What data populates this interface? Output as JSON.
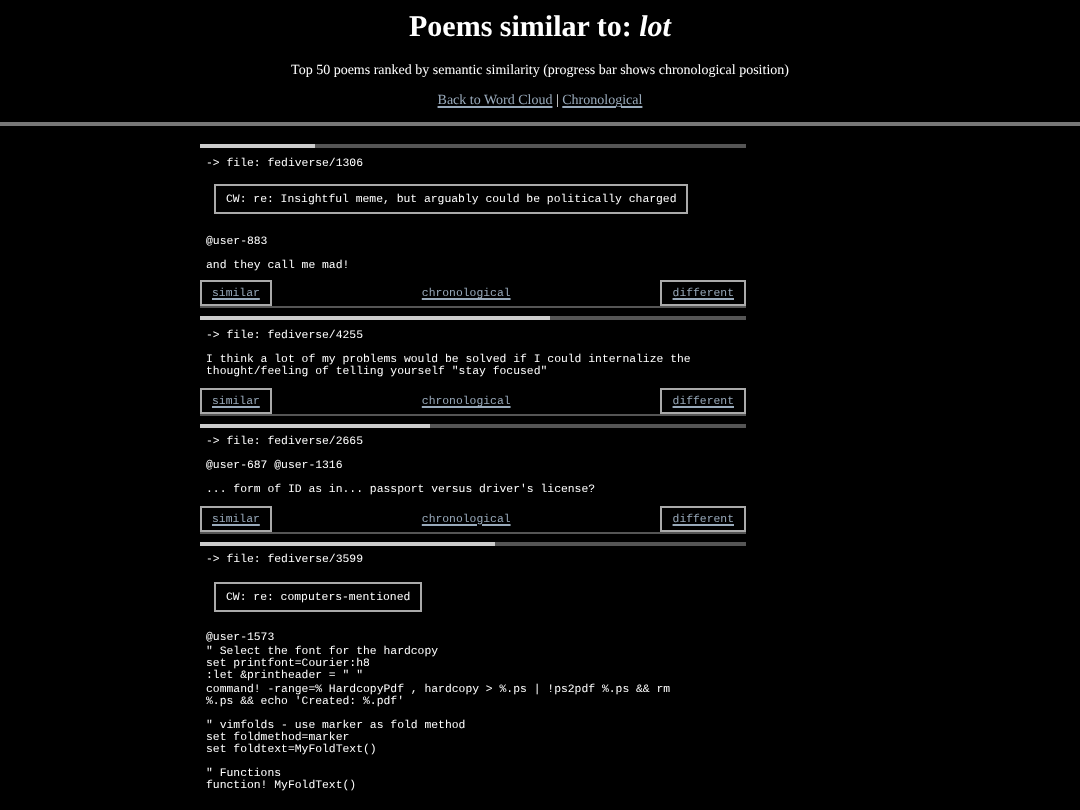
{
  "header": {
    "title": "Poems similar to:",
    "query": "lot",
    "subtitle": "Top 50 poems ranked by semantic similarity (progress bar shows chronological position)",
    "links": [
      "Back to Word Cloud",
      "Chronological"
    ],
    "separator": "|"
  },
  "poems": [
    {
      "level": 0.21,
      "file": "-> file: fediverse/1306",
      "cw": "CW: re: Insightful meme, but arguably could be politically charged",
      "paragraphs": [
        "@user-883",
        "and they call me mad!"
      ],
      "buttons": {
        "similar": "similar",
        "chronological": "chronological",
        "different": "different"
      }
    },
    {
      "level": 0.64,
      "file": "-> file: fediverse/4255",
      "paragraphs": [
        "I think a lot of my problems would be solved if I could internalize the\nthought/feeling of telling yourself \"stay focused\""
      ],
      "buttons": {
        "similar": "similar",
        "chronological": "chronological",
        "different": "different"
      }
    },
    {
      "level": 0.42,
      "file": "-> file: fediverse/2665",
      "paragraphs": [
        "@user-687 @user-1316",
        "... form of ID as in... passport versus driver's license?"
      ],
      "buttons": {
        "similar": "similar",
        "chronological": "chronological",
        "different": "different"
      }
    },
    {
      "level": 0.54,
      "file": "-> file: fediverse/3599",
      "cw": "CW: re: computers-mentioned",
      "paragraphs": [
        "@user-1573\n\" Select the font for the hardcopy\nset printfont=Courier:h8\n:let &printheader = \" \"\ncommand! -range=% HardcopyPdf , hardcopy > %.ps | !ps2pdf %.ps && rm\n%.ps && echo 'Created: %.pdf'",
        "\" vimfolds - use marker as fold method\nset foldmethod=marker\nset foldtext=MyFoldText()",
        "\" Functions\nfunction! MyFoldText()"
      ]
    }
  ]
}
